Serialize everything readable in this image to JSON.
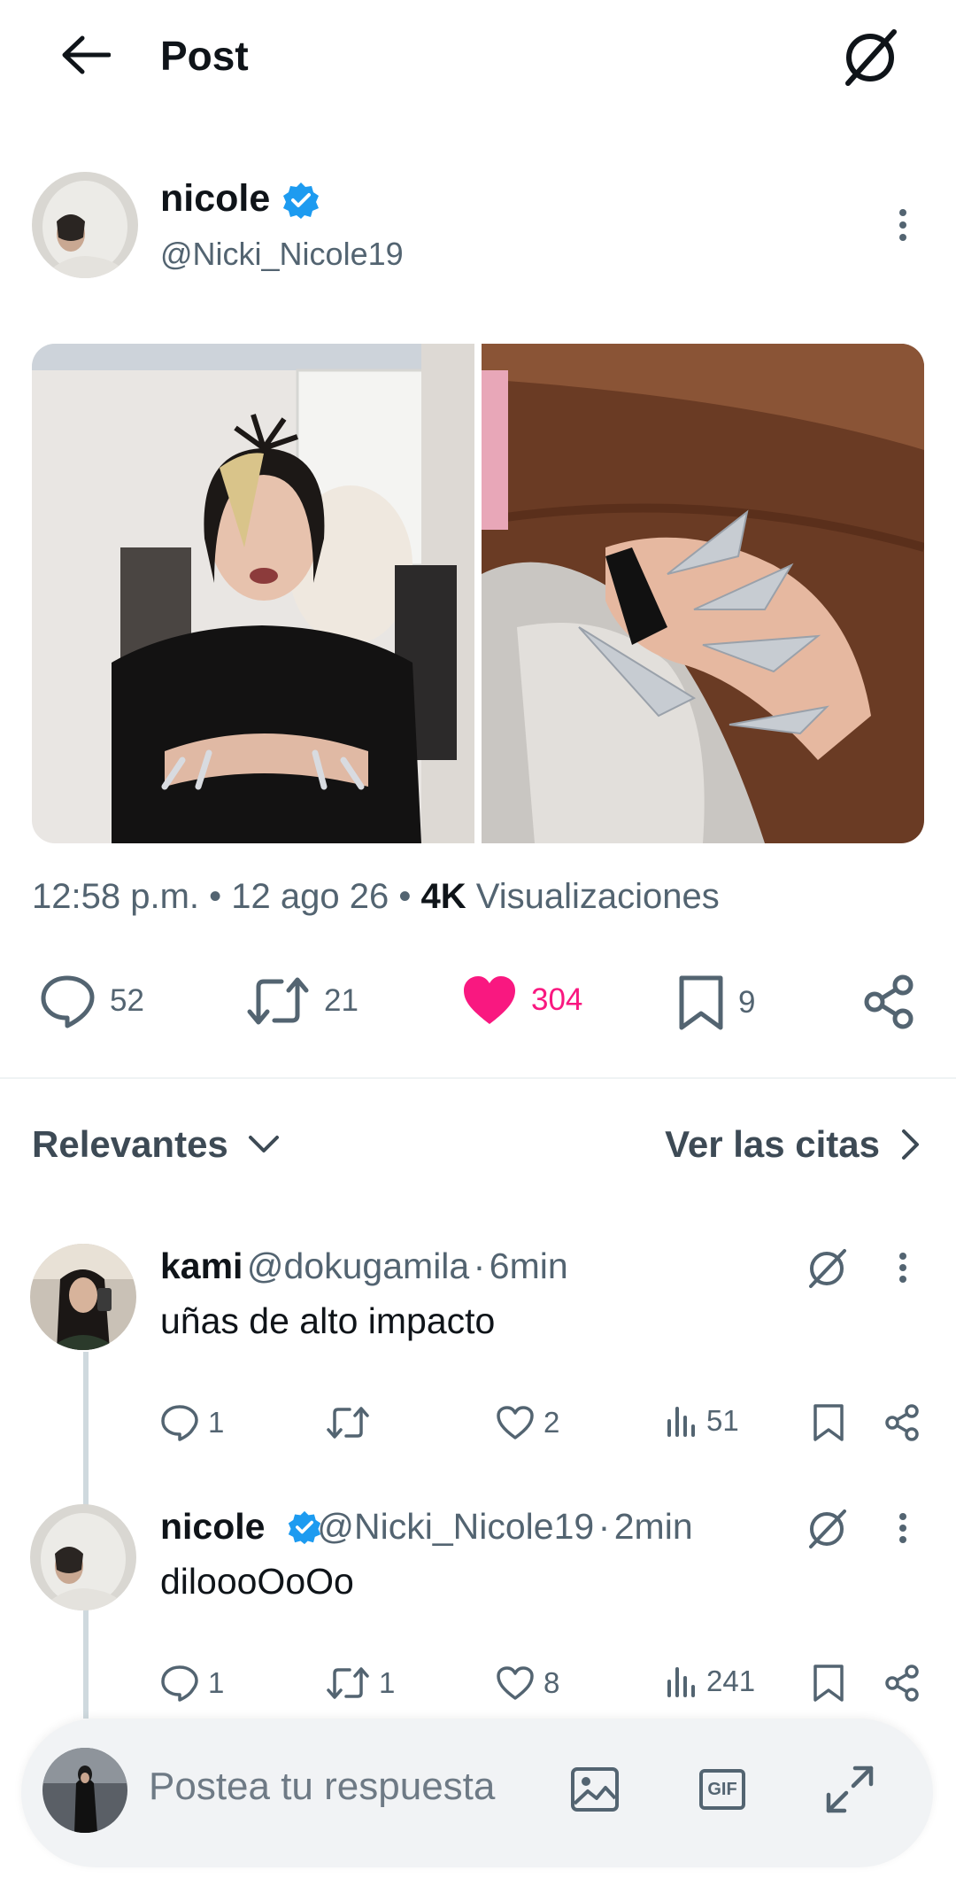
{
  "header": {
    "title": "Post"
  },
  "author": {
    "name": "nicole",
    "handle": "@Nicki_Nicole19"
  },
  "post": {
    "time": "12:58 p.m.",
    "date": "12 ago 26",
    "views_count": "4K",
    "views_label": "Visualizaciones",
    "separator": "•"
  },
  "actions": {
    "replies": "52",
    "reposts": "21",
    "likes": "304",
    "bookmarks": "9"
  },
  "sort": {
    "label": "Relevantes"
  },
  "quotes": {
    "label": "Ver las citas"
  },
  "replies": [
    {
      "name": "kami",
      "handle": "@dokugamila",
      "dot": "·",
      "time": "6min",
      "text": "uñas de alto impacto",
      "comments": "1",
      "reposts": "",
      "likes": "2",
      "views": "51"
    },
    {
      "name": "nicole",
      "handle": "@Nicki_Nicole19",
      "dot": "·",
      "time": "2min",
      "text": "dilooоOoOo",
      "comments": "1",
      "reposts": "1",
      "likes": "8",
      "views": "241"
    }
  ],
  "composer": {
    "placeholder": "Postea tu respuesta",
    "gif_label": "GIF"
  },
  "colors": {
    "like": "#f91880",
    "verified": "#1d9bf0",
    "muted": "#536471"
  }
}
